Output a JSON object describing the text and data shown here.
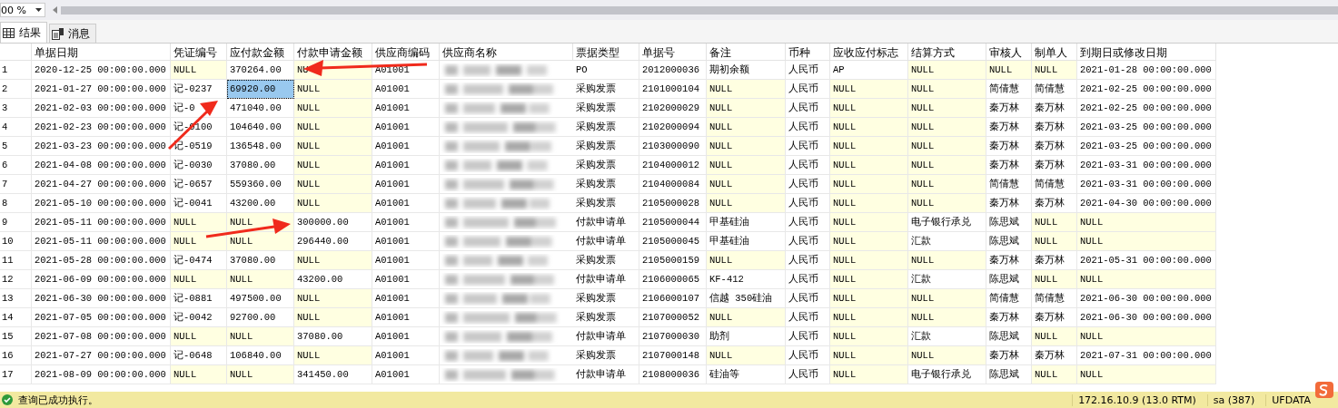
{
  "toolbar": {
    "zoom": "00 %"
  },
  "tabs": [
    {
      "label": "结果",
      "selected": true
    },
    {
      "label": "消息",
      "selected": false
    }
  ],
  "table": {
    "columns": [
      "单据日期",
      "凭证编号",
      "应付款金额",
      "付款申请金额",
      "供应商编码",
      "供应商名称",
      "票据类型",
      "单据号",
      "备注",
      "币种",
      "应收应付标志",
      "结算方式",
      "审核人",
      "制单人",
      "到期日或修改日期"
    ],
    "rows": [
      {
        "number": "1",
        "cells": [
          {
            "kind": "text",
            "text": "2020-12-25 00:00:00.000",
            "is_null": false,
            "selected": false
          },
          {
            "kind": "text",
            "text": "NULL",
            "is_null": true,
            "selected": false
          },
          {
            "kind": "text",
            "text": "370264.00",
            "is_null": false,
            "selected": false
          },
          {
            "kind": "text",
            "text": "NU",
            "is_null": true,
            "selected": false
          },
          {
            "kind": "text",
            "text": "A01001",
            "is_null": false,
            "selected": false
          },
          {
            "kind": "redacted"
          },
          {
            "kind": "text",
            "text": "PO",
            "is_null": false,
            "selected": false
          },
          {
            "kind": "text",
            "text": "2012000036",
            "is_null": false,
            "selected": false
          },
          {
            "kind": "text",
            "text": "期初余额",
            "is_null": false,
            "selected": false
          },
          {
            "kind": "text",
            "text": "人民币",
            "is_null": false,
            "selected": false
          },
          {
            "kind": "text",
            "text": "AP",
            "is_null": false,
            "selected": false
          },
          {
            "kind": "text",
            "text": "NULL",
            "is_null": true,
            "selected": false
          },
          {
            "kind": "text",
            "text": "NULL",
            "is_null": true,
            "selected": false
          },
          {
            "kind": "text",
            "text": "NULL",
            "is_null": true,
            "selected": false
          },
          {
            "kind": "text",
            "text": "2021-01-28 00:00:00.000",
            "is_null": false,
            "selected": false
          }
        ]
      },
      {
        "number": "2",
        "cells": [
          {
            "kind": "text",
            "text": "2021-01-27 00:00:00.000",
            "is_null": false,
            "selected": false
          },
          {
            "kind": "text",
            "text": "记-0237",
            "is_null": false,
            "selected": false
          },
          {
            "kind": "text",
            "text": "69920.00",
            "is_null": false,
            "selected": true
          },
          {
            "kind": "text",
            "text": "NULL",
            "is_null": true,
            "selected": false
          },
          {
            "kind": "text",
            "text": "A01001",
            "is_null": false,
            "selected": false
          },
          {
            "kind": "redacted"
          },
          {
            "kind": "text",
            "text": "采购发票",
            "is_null": false,
            "selected": false
          },
          {
            "kind": "text",
            "text": "2101000104",
            "is_null": false,
            "selected": false
          },
          {
            "kind": "text",
            "text": "NULL",
            "is_null": true,
            "selected": false
          },
          {
            "kind": "text",
            "text": "人民币",
            "is_null": false,
            "selected": false
          },
          {
            "kind": "text",
            "text": "NULL",
            "is_null": true,
            "selected": false
          },
          {
            "kind": "text",
            "text": "NULL",
            "is_null": true,
            "selected": false
          },
          {
            "kind": "text",
            "text": "简倩慧",
            "is_null": false,
            "selected": false
          },
          {
            "kind": "text",
            "text": "简倩慧",
            "is_null": false,
            "selected": false
          },
          {
            "kind": "text",
            "text": "2021-02-25 00:00:00.000",
            "is_null": false,
            "selected": false
          }
        ]
      },
      {
        "number": "3",
        "cells": [
          {
            "kind": "text",
            "text": "2021-02-03 00:00:00.000",
            "is_null": false,
            "selected": false
          },
          {
            "kind": "text",
            "text": "记-0",
            "is_null": false,
            "selected": false
          },
          {
            "kind": "text",
            "text": "471040.00",
            "is_null": false,
            "selected": false
          },
          {
            "kind": "text",
            "text": "NULL",
            "is_null": true,
            "selected": false
          },
          {
            "kind": "text",
            "text": "A01001",
            "is_null": false,
            "selected": false
          },
          {
            "kind": "redacted"
          },
          {
            "kind": "text",
            "text": "采购发票",
            "is_null": false,
            "selected": false
          },
          {
            "kind": "text",
            "text": "2102000029",
            "is_null": false,
            "selected": false
          },
          {
            "kind": "text",
            "text": "NULL",
            "is_null": true,
            "selected": false
          },
          {
            "kind": "text",
            "text": "人民币",
            "is_null": false,
            "selected": false
          },
          {
            "kind": "text",
            "text": "NULL",
            "is_null": true,
            "selected": false
          },
          {
            "kind": "text",
            "text": "NULL",
            "is_null": true,
            "selected": false
          },
          {
            "kind": "text",
            "text": "秦万林",
            "is_null": false,
            "selected": false
          },
          {
            "kind": "text",
            "text": "秦万林",
            "is_null": false,
            "selected": false
          },
          {
            "kind": "text",
            "text": "2021-02-25 00:00:00.000",
            "is_null": false,
            "selected": false
          }
        ]
      },
      {
        "number": "4",
        "cells": [
          {
            "kind": "text",
            "text": "2021-02-23 00:00:00.000",
            "is_null": false,
            "selected": false
          },
          {
            "kind": "text",
            "text": "记-0100",
            "is_null": false,
            "selected": false
          },
          {
            "kind": "text",
            "text": "104640.00",
            "is_null": false,
            "selected": false
          },
          {
            "kind": "text",
            "text": "NULL",
            "is_null": true,
            "selected": false
          },
          {
            "kind": "text",
            "text": "A01001",
            "is_null": false,
            "selected": false
          },
          {
            "kind": "redacted"
          },
          {
            "kind": "text",
            "text": "采购发票",
            "is_null": false,
            "selected": false
          },
          {
            "kind": "text",
            "text": "2102000094",
            "is_null": false,
            "selected": false
          },
          {
            "kind": "text",
            "text": "NULL",
            "is_null": true,
            "selected": false
          },
          {
            "kind": "text",
            "text": "人民币",
            "is_null": false,
            "selected": false
          },
          {
            "kind": "text",
            "text": "NULL",
            "is_null": true,
            "selected": false
          },
          {
            "kind": "text",
            "text": "NULL",
            "is_null": true,
            "selected": false
          },
          {
            "kind": "text",
            "text": "秦万林",
            "is_null": false,
            "selected": false
          },
          {
            "kind": "text",
            "text": "秦万林",
            "is_null": false,
            "selected": false
          },
          {
            "kind": "text",
            "text": "2021-03-25 00:00:00.000",
            "is_null": false,
            "selected": false
          }
        ]
      },
      {
        "number": "5",
        "cells": [
          {
            "kind": "text",
            "text": "2021-03-23 00:00:00.000",
            "is_null": false,
            "selected": false
          },
          {
            "kind": "text",
            "text": "记-0519",
            "is_null": false,
            "selected": false
          },
          {
            "kind": "text",
            "text": "136548.00",
            "is_null": false,
            "selected": false
          },
          {
            "kind": "text",
            "text": "NULL",
            "is_null": true,
            "selected": false
          },
          {
            "kind": "text",
            "text": "A01001",
            "is_null": false,
            "selected": false
          },
          {
            "kind": "redacted"
          },
          {
            "kind": "text",
            "text": "采购发票",
            "is_null": false,
            "selected": false
          },
          {
            "kind": "text",
            "text": "2103000090",
            "is_null": false,
            "selected": false
          },
          {
            "kind": "text",
            "text": "NULL",
            "is_null": true,
            "selected": false
          },
          {
            "kind": "text",
            "text": "人民币",
            "is_null": false,
            "selected": false
          },
          {
            "kind": "text",
            "text": "NULL",
            "is_null": true,
            "selected": false
          },
          {
            "kind": "text",
            "text": "NULL",
            "is_null": true,
            "selected": false
          },
          {
            "kind": "text",
            "text": "秦万林",
            "is_null": false,
            "selected": false
          },
          {
            "kind": "text",
            "text": "秦万林",
            "is_null": false,
            "selected": false
          },
          {
            "kind": "text",
            "text": "2021-03-25 00:00:00.000",
            "is_null": false,
            "selected": false
          }
        ]
      },
      {
        "number": "6",
        "cells": [
          {
            "kind": "text",
            "text": "2021-04-08 00:00:00.000",
            "is_null": false,
            "selected": false
          },
          {
            "kind": "text",
            "text": "记-0030",
            "is_null": false,
            "selected": false
          },
          {
            "kind": "text",
            "text": "37080.00",
            "is_null": false,
            "selected": false
          },
          {
            "kind": "text",
            "text": "NULL",
            "is_null": true,
            "selected": false
          },
          {
            "kind": "text",
            "text": "A01001",
            "is_null": false,
            "selected": false
          },
          {
            "kind": "redacted"
          },
          {
            "kind": "text",
            "text": "采购发票",
            "is_null": false,
            "selected": false
          },
          {
            "kind": "text",
            "text": "2104000012",
            "is_null": false,
            "selected": false
          },
          {
            "kind": "text",
            "text": "NULL",
            "is_null": true,
            "selected": false
          },
          {
            "kind": "text",
            "text": "人民币",
            "is_null": false,
            "selected": false
          },
          {
            "kind": "text",
            "text": "NULL",
            "is_null": true,
            "selected": false
          },
          {
            "kind": "text",
            "text": "NULL",
            "is_null": true,
            "selected": false
          },
          {
            "kind": "text",
            "text": "秦万林",
            "is_null": false,
            "selected": false
          },
          {
            "kind": "text",
            "text": "秦万林",
            "is_null": false,
            "selected": false
          },
          {
            "kind": "text",
            "text": "2021-03-31 00:00:00.000",
            "is_null": false,
            "selected": false
          }
        ]
      },
      {
        "number": "7",
        "cells": [
          {
            "kind": "text",
            "text": "2021-04-27 00:00:00.000",
            "is_null": false,
            "selected": false
          },
          {
            "kind": "text",
            "text": "记-0657",
            "is_null": false,
            "selected": false
          },
          {
            "kind": "text",
            "text": "559360.00",
            "is_null": false,
            "selected": false
          },
          {
            "kind": "text",
            "text": "NULL",
            "is_null": true,
            "selected": false
          },
          {
            "kind": "text",
            "text": "A01001",
            "is_null": false,
            "selected": false
          },
          {
            "kind": "redacted"
          },
          {
            "kind": "text",
            "text": "采购发票",
            "is_null": false,
            "selected": false
          },
          {
            "kind": "text",
            "text": "2104000084",
            "is_null": false,
            "selected": false
          },
          {
            "kind": "text",
            "text": "NULL",
            "is_null": true,
            "selected": false
          },
          {
            "kind": "text",
            "text": "人民币",
            "is_null": false,
            "selected": false
          },
          {
            "kind": "text",
            "text": "NULL",
            "is_null": true,
            "selected": false
          },
          {
            "kind": "text",
            "text": "NULL",
            "is_null": true,
            "selected": false
          },
          {
            "kind": "text",
            "text": "简倩慧",
            "is_null": false,
            "selected": false
          },
          {
            "kind": "text",
            "text": "简倩慧",
            "is_null": false,
            "selected": false
          },
          {
            "kind": "text",
            "text": "2021-03-31 00:00:00.000",
            "is_null": false,
            "selected": false
          }
        ]
      },
      {
        "number": "8",
        "cells": [
          {
            "kind": "text",
            "text": "2021-05-10 00:00:00.000",
            "is_null": false,
            "selected": false
          },
          {
            "kind": "text",
            "text": "记-0041",
            "is_null": false,
            "selected": false
          },
          {
            "kind": "text",
            "text": "43200.00",
            "is_null": false,
            "selected": false
          },
          {
            "kind": "text",
            "text": "NULL",
            "is_null": true,
            "selected": false
          },
          {
            "kind": "text",
            "text": "A01001",
            "is_null": false,
            "selected": false
          },
          {
            "kind": "redacted"
          },
          {
            "kind": "text",
            "text": "采购发票",
            "is_null": false,
            "selected": false
          },
          {
            "kind": "text",
            "text": "2105000028",
            "is_null": false,
            "selected": false
          },
          {
            "kind": "text",
            "text": "NULL",
            "is_null": true,
            "selected": false
          },
          {
            "kind": "text",
            "text": "人民币",
            "is_null": false,
            "selected": false
          },
          {
            "kind": "text",
            "text": "NULL",
            "is_null": true,
            "selected": false
          },
          {
            "kind": "text",
            "text": "NULL",
            "is_null": true,
            "selected": false
          },
          {
            "kind": "text",
            "text": "秦万林",
            "is_null": false,
            "selected": false
          },
          {
            "kind": "text",
            "text": "秦万林",
            "is_null": false,
            "selected": false
          },
          {
            "kind": "text",
            "text": "2021-04-30 00:00:00.000",
            "is_null": false,
            "selected": false
          }
        ]
      },
      {
        "number": "9",
        "cells": [
          {
            "kind": "text",
            "text": "2021-05-11 00:00:00.000",
            "is_null": false,
            "selected": false
          },
          {
            "kind": "text",
            "text": "NULL",
            "is_null": true,
            "selected": false
          },
          {
            "kind": "text",
            "text": "NULL",
            "is_null": true,
            "selected": false
          },
          {
            "kind": "text",
            "text": "300000.00",
            "is_null": false,
            "selected": false
          },
          {
            "kind": "text",
            "text": "A01001",
            "is_null": false,
            "selected": false
          },
          {
            "kind": "redacted"
          },
          {
            "kind": "text",
            "text": "付款申请单",
            "is_null": false,
            "selected": false
          },
          {
            "kind": "text",
            "text": "2105000044",
            "is_null": false,
            "selected": false
          },
          {
            "kind": "text",
            "text": "甲基硅油",
            "is_null": false,
            "selected": false
          },
          {
            "kind": "text",
            "text": "人民币",
            "is_null": false,
            "selected": false
          },
          {
            "kind": "text",
            "text": "NULL",
            "is_null": true,
            "selected": false
          },
          {
            "kind": "text",
            "text": "电子银行承兑",
            "is_null": false,
            "selected": false
          },
          {
            "kind": "text",
            "text": "陈思斌",
            "is_null": false,
            "selected": false
          },
          {
            "kind": "text",
            "text": "NULL",
            "is_null": true,
            "selected": false
          },
          {
            "kind": "text",
            "text": "NULL",
            "is_null": true,
            "selected": false
          }
        ]
      },
      {
        "number": "10",
        "cells": [
          {
            "kind": "text",
            "text": "2021-05-11 00:00:00.000",
            "is_null": false,
            "selected": false
          },
          {
            "kind": "text",
            "text": "NULL",
            "is_null": true,
            "selected": false
          },
          {
            "kind": "text",
            "text": "NULL",
            "is_null": true,
            "selected": false
          },
          {
            "kind": "text",
            "text": "296440.00",
            "is_null": false,
            "selected": false
          },
          {
            "kind": "text",
            "text": "A01001",
            "is_null": false,
            "selected": false
          },
          {
            "kind": "redacted"
          },
          {
            "kind": "text",
            "text": "付款申请单",
            "is_null": false,
            "selected": false
          },
          {
            "kind": "text",
            "text": "2105000045",
            "is_null": false,
            "selected": false
          },
          {
            "kind": "text",
            "text": "甲基硅油",
            "is_null": false,
            "selected": false
          },
          {
            "kind": "text",
            "text": "人民币",
            "is_null": false,
            "selected": false
          },
          {
            "kind": "text",
            "text": "NULL",
            "is_null": true,
            "selected": false
          },
          {
            "kind": "text",
            "text": "汇款",
            "is_null": false,
            "selected": false
          },
          {
            "kind": "text",
            "text": "陈思斌",
            "is_null": false,
            "selected": false
          },
          {
            "kind": "text",
            "text": "NULL",
            "is_null": true,
            "selected": false
          },
          {
            "kind": "text",
            "text": "NULL",
            "is_null": true,
            "selected": false
          }
        ]
      },
      {
        "number": "11",
        "cells": [
          {
            "kind": "text",
            "text": "2021-05-28 00:00:00.000",
            "is_null": false,
            "selected": false
          },
          {
            "kind": "text",
            "text": "记-0474",
            "is_null": false,
            "selected": false
          },
          {
            "kind": "text",
            "text": "37080.00",
            "is_null": false,
            "selected": false
          },
          {
            "kind": "text",
            "text": "NULL",
            "is_null": true,
            "selected": false
          },
          {
            "kind": "text",
            "text": "A01001",
            "is_null": false,
            "selected": false
          },
          {
            "kind": "redacted"
          },
          {
            "kind": "text",
            "text": "采购发票",
            "is_null": false,
            "selected": false
          },
          {
            "kind": "text",
            "text": "2105000159",
            "is_null": false,
            "selected": false
          },
          {
            "kind": "text",
            "text": "NULL",
            "is_null": true,
            "selected": false
          },
          {
            "kind": "text",
            "text": "人民币",
            "is_null": false,
            "selected": false
          },
          {
            "kind": "text",
            "text": "NULL",
            "is_null": true,
            "selected": false
          },
          {
            "kind": "text",
            "text": "NULL",
            "is_null": true,
            "selected": false
          },
          {
            "kind": "text",
            "text": "秦万林",
            "is_null": false,
            "selected": false
          },
          {
            "kind": "text",
            "text": "秦万林",
            "is_null": false,
            "selected": false
          },
          {
            "kind": "text",
            "text": "2021-05-31 00:00:00.000",
            "is_null": false,
            "selected": false
          }
        ]
      },
      {
        "number": "12",
        "cells": [
          {
            "kind": "text",
            "text": "2021-06-09 00:00:00.000",
            "is_null": false,
            "selected": false
          },
          {
            "kind": "text",
            "text": "NULL",
            "is_null": true,
            "selected": false
          },
          {
            "kind": "text",
            "text": "NULL",
            "is_null": true,
            "selected": false
          },
          {
            "kind": "text",
            "text": "43200.00",
            "is_null": false,
            "selected": false
          },
          {
            "kind": "text",
            "text": "A01001",
            "is_null": false,
            "selected": false
          },
          {
            "kind": "redacted"
          },
          {
            "kind": "text",
            "text": "付款申请单",
            "is_null": false,
            "selected": false
          },
          {
            "kind": "text",
            "text": "2106000065",
            "is_null": false,
            "selected": false
          },
          {
            "kind": "text",
            "text": "KF-412",
            "is_null": false,
            "selected": false
          },
          {
            "kind": "text",
            "text": "人民币",
            "is_null": false,
            "selected": false
          },
          {
            "kind": "text",
            "text": "NULL",
            "is_null": true,
            "selected": false
          },
          {
            "kind": "text",
            "text": "汇款",
            "is_null": false,
            "selected": false
          },
          {
            "kind": "text",
            "text": "陈思斌",
            "is_null": false,
            "selected": false
          },
          {
            "kind": "text",
            "text": "NULL",
            "is_null": true,
            "selected": false
          },
          {
            "kind": "text",
            "text": "NULL",
            "is_null": true,
            "selected": false
          }
        ]
      },
      {
        "number": "13",
        "cells": [
          {
            "kind": "text",
            "text": "2021-06-30 00:00:00.000",
            "is_null": false,
            "selected": false
          },
          {
            "kind": "text",
            "text": "记-0881",
            "is_null": false,
            "selected": false
          },
          {
            "kind": "text",
            "text": "497500.00",
            "is_null": false,
            "selected": false
          },
          {
            "kind": "text",
            "text": "NULL",
            "is_null": true,
            "selected": false
          },
          {
            "kind": "text",
            "text": "A01001",
            "is_null": false,
            "selected": false
          },
          {
            "kind": "redacted"
          },
          {
            "kind": "text",
            "text": "采购发票",
            "is_null": false,
            "selected": false
          },
          {
            "kind": "text",
            "text": "2106000107",
            "is_null": false,
            "selected": false
          },
          {
            "kind": "text",
            "text": "信越 350硅油",
            "is_null": false,
            "selected": false
          },
          {
            "kind": "text",
            "text": "人民币",
            "is_null": false,
            "selected": false
          },
          {
            "kind": "text",
            "text": "NULL",
            "is_null": true,
            "selected": false
          },
          {
            "kind": "text",
            "text": "NULL",
            "is_null": true,
            "selected": false
          },
          {
            "kind": "text",
            "text": "简倩慧",
            "is_null": false,
            "selected": false
          },
          {
            "kind": "text",
            "text": "简倩慧",
            "is_null": false,
            "selected": false
          },
          {
            "kind": "text",
            "text": "2021-06-30 00:00:00.000",
            "is_null": false,
            "selected": false
          }
        ]
      },
      {
        "number": "14",
        "cells": [
          {
            "kind": "text",
            "text": "2021-07-05 00:00:00.000",
            "is_null": false,
            "selected": false
          },
          {
            "kind": "text",
            "text": "记-0042",
            "is_null": false,
            "selected": false
          },
          {
            "kind": "text",
            "text": "92700.00",
            "is_null": false,
            "selected": false
          },
          {
            "kind": "text",
            "text": "NULL",
            "is_null": true,
            "selected": false
          },
          {
            "kind": "text",
            "text": "A01001",
            "is_null": false,
            "selected": false
          },
          {
            "kind": "redacted"
          },
          {
            "kind": "text",
            "text": "采购发票",
            "is_null": false,
            "selected": false
          },
          {
            "kind": "text",
            "text": "2107000052",
            "is_null": false,
            "selected": false
          },
          {
            "kind": "text",
            "text": "NULL",
            "is_null": true,
            "selected": false
          },
          {
            "kind": "text",
            "text": "人民币",
            "is_null": false,
            "selected": false
          },
          {
            "kind": "text",
            "text": "NULL",
            "is_null": true,
            "selected": false
          },
          {
            "kind": "text",
            "text": "NULL",
            "is_null": true,
            "selected": false
          },
          {
            "kind": "text",
            "text": "秦万林",
            "is_null": false,
            "selected": false
          },
          {
            "kind": "text",
            "text": "秦万林",
            "is_null": false,
            "selected": false
          },
          {
            "kind": "text",
            "text": "2021-06-30 00:00:00.000",
            "is_null": false,
            "selected": false
          }
        ]
      },
      {
        "number": "15",
        "cells": [
          {
            "kind": "text",
            "text": "2021-07-08 00:00:00.000",
            "is_null": false,
            "selected": false
          },
          {
            "kind": "text",
            "text": "NULL",
            "is_null": true,
            "selected": false
          },
          {
            "kind": "text",
            "text": "NULL",
            "is_null": true,
            "selected": false
          },
          {
            "kind": "text",
            "text": "37080.00",
            "is_null": false,
            "selected": false
          },
          {
            "kind": "text",
            "text": "A01001",
            "is_null": false,
            "selected": false
          },
          {
            "kind": "redacted"
          },
          {
            "kind": "text",
            "text": "付款申请单",
            "is_null": false,
            "selected": false
          },
          {
            "kind": "text",
            "text": "2107000030",
            "is_null": false,
            "selected": false
          },
          {
            "kind": "text",
            "text": "助剂",
            "is_null": false,
            "selected": false
          },
          {
            "kind": "text",
            "text": "人民币",
            "is_null": false,
            "selected": false
          },
          {
            "kind": "text",
            "text": "NULL",
            "is_null": true,
            "selected": false
          },
          {
            "kind": "text",
            "text": "汇款",
            "is_null": false,
            "selected": false
          },
          {
            "kind": "text",
            "text": "陈思斌",
            "is_null": false,
            "selected": false
          },
          {
            "kind": "text",
            "text": "NULL",
            "is_null": true,
            "selected": false
          },
          {
            "kind": "text",
            "text": "NULL",
            "is_null": true,
            "selected": false
          }
        ]
      },
      {
        "number": "16",
        "cells": [
          {
            "kind": "text",
            "text": "2021-07-27 00:00:00.000",
            "is_null": false,
            "selected": false
          },
          {
            "kind": "text",
            "text": "记-0648",
            "is_null": false,
            "selected": false
          },
          {
            "kind": "text",
            "text": "106840.00",
            "is_null": false,
            "selected": false
          },
          {
            "kind": "text",
            "text": "NULL",
            "is_null": true,
            "selected": false
          },
          {
            "kind": "text",
            "text": "A01001",
            "is_null": false,
            "selected": false
          },
          {
            "kind": "redacted"
          },
          {
            "kind": "text",
            "text": "采购发票",
            "is_null": false,
            "selected": false
          },
          {
            "kind": "text",
            "text": "2107000148",
            "is_null": false,
            "selected": false
          },
          {
            "kind": "text",
            "text": "NULL",
            "is_null": true,
            "selected": false
          },
          {
            "kind": "text",
            "text": "人民币",
            "is_null": false,
            "selected": false
          },
          {
            "kind": "text",
            "text": "NULL",
            "is_null": true,
            "selected": false
          },
          {
            "kind": "text",
            "text": "NULL",
            "is_null": true,
            "selected": false
          },
          {
            "kind": "text",
            "text": "秦万林",
            "is_null": false,
            "selected": false
          },
          {
            "kind": "text",
            "text": "秦万林",
            "is_null": false,
            "selected": false
          },
          {
            "kind": "text",
            "text": "2021-07-31 00:00:00.000",
            "is_null": false,
            "selected": false
          }
        ]
      },
      {
        "number": "17",
        "cells": [
          {
            "kind": "text",
            "text": "2021-08-09 00:00:00.000",
            "is_null": false,
            "selected": false
          },
          {
            "kind": "text",
            "text": "NULL",
            "is_null": true,
            "selected": false
          },
          {
            "kind": "text",
            "text": "NULL",
            "is_null": true,
            "selected": false
          },
          {
            "kind": "text",
            "text": "341450.00",
            "is_null": false,
            "selected": false
          },
          {
            "kind": "text",
            "text": "A01001",
            "is_null": false,
            "selected": false
          },
          {
            "kind": "redacted"
          },
          {
            "kind": "text",
            "text": "付款申请单",
            "is_null": false,
            "selected": false
          },
          {
            "kind": "text",
            "text": "2108000036",
            "is_null": false,
            "selected": false
          },
          {
            "kind": "text",
            "text": "硅油等",
            "is_null": false,
            "selected": false
          },
          {
            "kind": "text",
            "text": "人民币",
            "is_null": false,
            "selected": false
          },
          {
            "kind": "text",
            "text": "NULL",
            "is_null": true,
            "selected": false
          },
          {
            "kind": "text",
            "text": "电子银行承兑",
            "is_null": false,
            "selected": false
          },
          {
            "kind": "text",
            "text": "陈思斌",
            "is_null": false,
            "selected": false
          },
          {
            "kind": "text",
            "text": "NULL",
            "is_null": true,
            "selected": false
          },
          {
            "kind": "text",
            "text": "NULL",
            "is_null": true,
            "selected": false
          }
        ]
      }
    ]
  },
  "status_bar": {
    "message": "查询已成功执行。",
    "server": "172.16.10.9 (13.0 RTM)",
    "user": "sa (387)",
    "database": "UFDATA"
  }
}
